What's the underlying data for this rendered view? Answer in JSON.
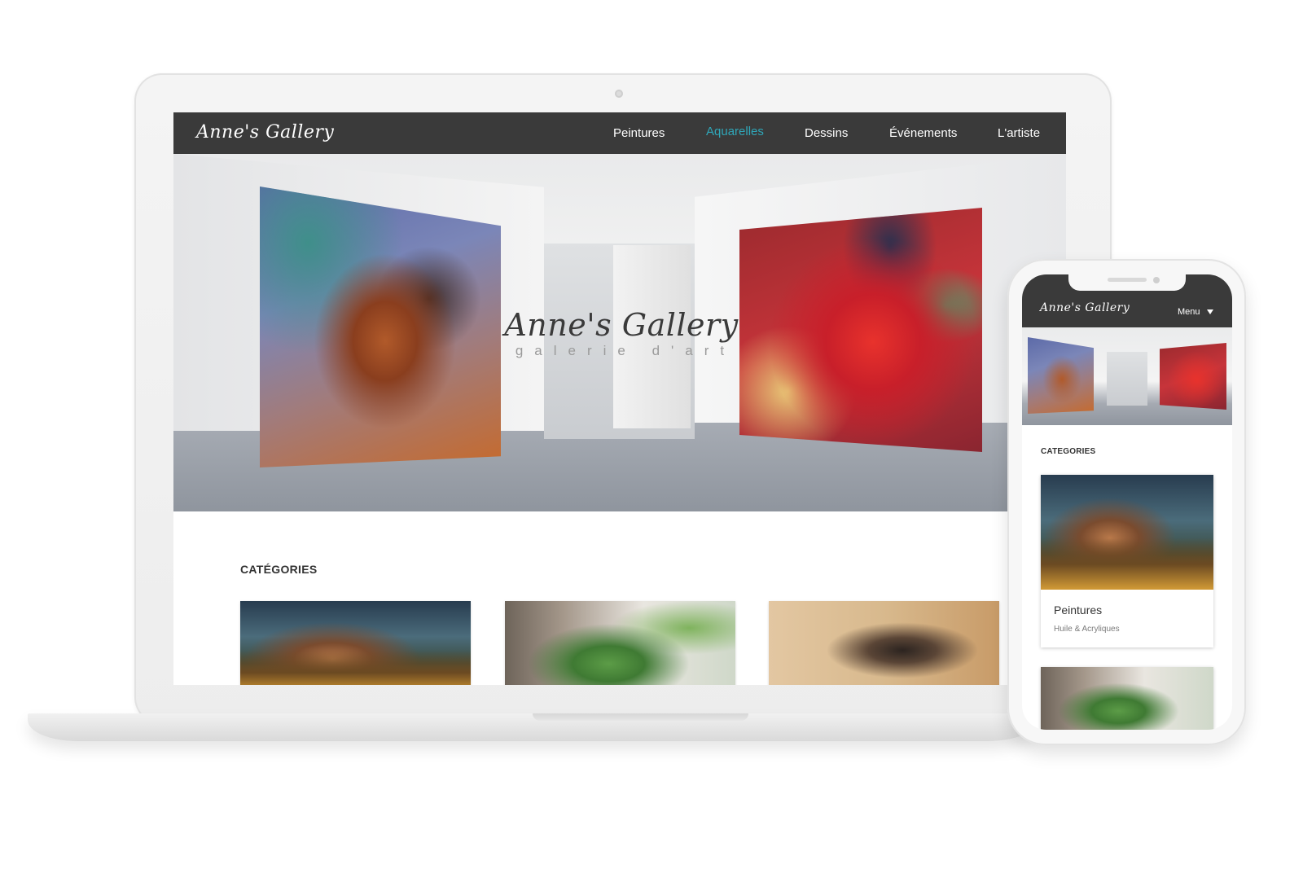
{
  "desktop": {
    "brand": "Anne's Gallery",
    "nav": [
      {
        "label": "Peintures",
        "active": false
      },
      {
        "label": "Aquarelles",
        "active": true
      },
      {
        "label": "Dessins",
        "active": false
      },
      {
        "label": "Événements",
        "active": false
      },
      {
        "label": "L'artiste",
        "active": false
      }
    ],
    "hero": {
      "title": "Anne's Gallery",
      "subtitle": "galerie d'art"
    },
    "categories_title": "CATÉGORIES"
  },
  "mobile": {
    "brand": "Anne's Gallery",
    "menu_label": "Menu",
    "categories_title": "CATEGORIES",
    "card": {
      "title": "Peintures",
      "subtitle": "Huile & Acryliques"
    }
  },
  "colors": {
    "navbar": "#3a3a3a",
    "accent_active": "#2fa7b9"
  }
}
